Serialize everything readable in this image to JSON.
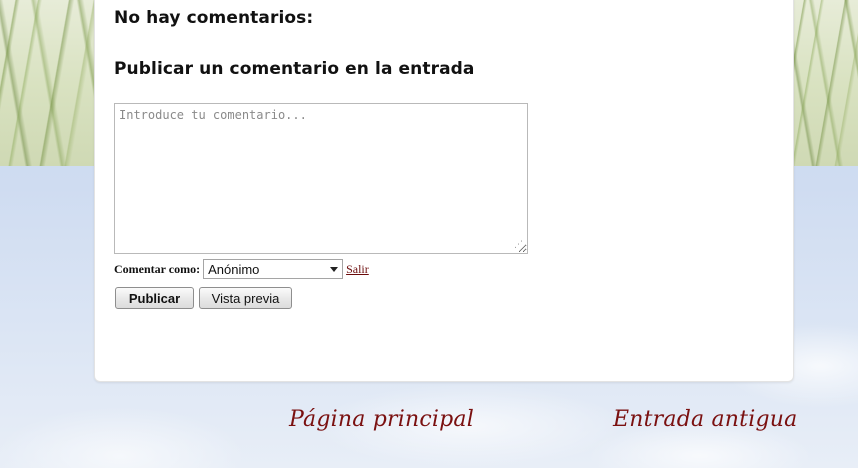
{
  "comments": {
    "none_heading": "No hay comentarios:",
    "post_heading": "Publicar un comentario en la entrada",
    "textarea_placeholder": "Introduce tu comentario...",
    "textarea_value": "",
    "comment_as_label": "Comentar como:",
    "identity_selected": "Anónimo",
    "logout_link": "Salir",
    "publish_button": "Publicar",
    "preview_button": "Vista previa"
  },
  "pager": {
    "home_link": "Página principal",
    "older_link": "Entrada antigua"
  },
  "colors": {
    "link_color": "#7a1010",
    "panel_bg": "#ffffff"
  },
  "icons": {
    "select_arrow": "chevron-down-icon",
    "resize_grip": "resize-grip-icon"
  }
}
